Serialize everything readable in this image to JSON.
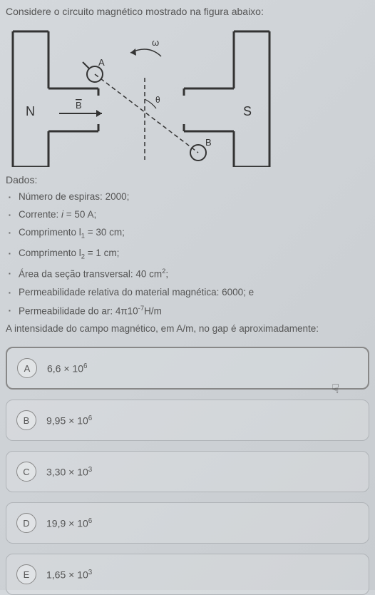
{
  "title": "Considere o circuito magnético mostrado na figura abaixo:",
  "diagram": {
    "labels": {
      "N": "N",
      "S": "S",
      "A": "A",
      "B": "B",
      "Bvec": "B",
      "omega": "ω",
      "theta": "θ"
    }
  },
  "dataHeading": "Dados:",
  "dataItems": {
    "item1_pre": "Número de espiras: ",
    "item1_val": "2000;",
    "item2_pre": "Corrente: ",
    "item2_var": "i",
    "item2_val": " = 50 A;",
    "item3_pre": "Comprimento l",
    "item3_sub": "1",
    "item3_val": " = 30 cm;",
    "item4_pre": "Comprimento l",
    "item4_sub": "2",
    "item4_val": " = 1 cm;",
    "item5_pre": "Área da seção transversal: 40 cm",
    "item5_sup": "2",
    "item5_suf": ";",
    "item6": "Permeabilidade relativa do material magnética: 6000; e",
    "item7_pre": "Permeabilidade do ar: 4π10",
    "item7_sup": "-7",
    "item7_suf": "H/m"
  },
  "questionText": "A intensidade do campo magnético, em A/m, no gap é aproximadamente:",
  "options": {
    "A": {
      "letter": "A",
      "pre": "6,6 × 10",
      "sup": "6"
    },
    "B": {
      "letter": "B",
      "pre": "9,95 × 10",
      "sup": "6"
    },
    "C": {
      "letter": "C",
      "pre": "3,30 × 10",
      "sup": "3"
    },
    "D": {
      "letter": "D",
      "pre": "19,9 × 10",
      "sup": "6"
    },
    "E": {
      "letter": "E",
      "pre": "1,65 × 10",
      "sup": "3"
    }
  },
  "selectedOption": "A"
}
